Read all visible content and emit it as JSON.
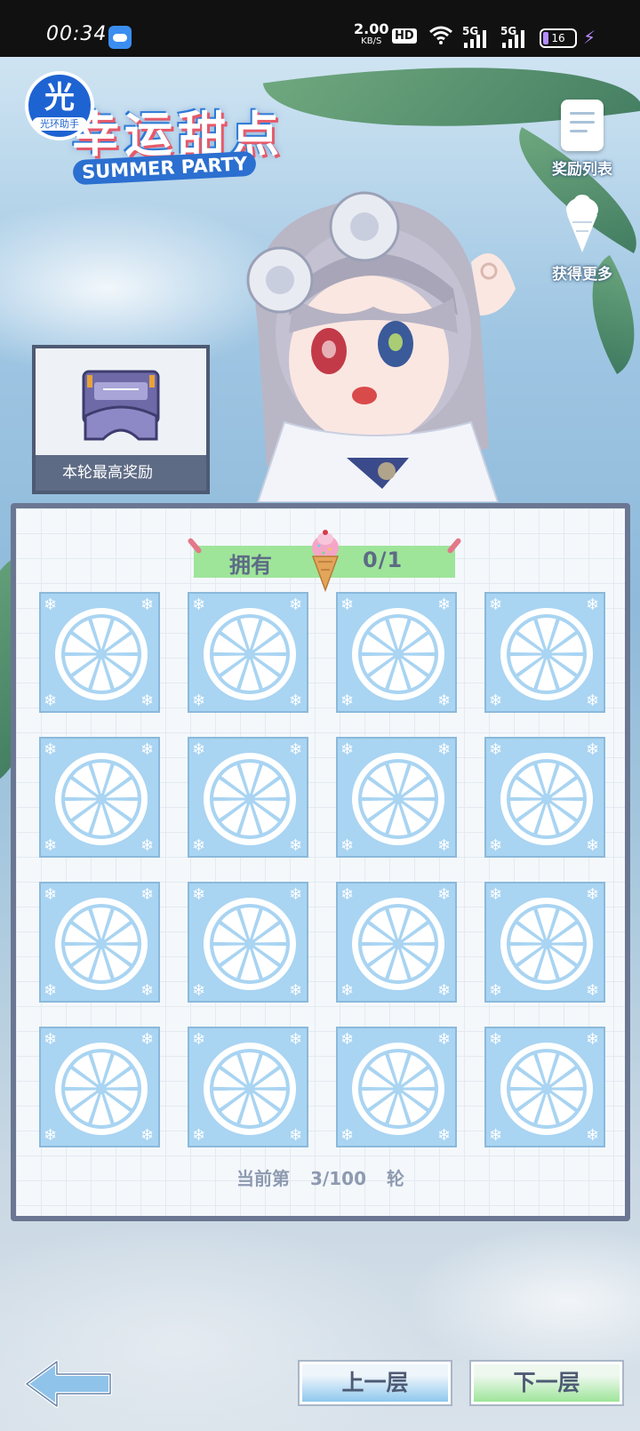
{
  "status_bar": {
    "time": "00:34",
    "speed_value": "2.00",
    "speed_unit": "KB/S",
    "hd_badge": "HD",
    "network1": "5G",
    "network2": "5G",
    "battery": "16"
  },
  "logo": {
    "title": "幸运甜点",
    "subtitle": "SUMMER PARTY",
    "assistant_big": "光",
    "assistant_small": "光环助手"
  },
  "side_buttons": {
    "reward_list": "奖励列表",
    "get_more": "获得更多"
  },
  "reward_box": {
    "label": "本轮最高奖励"
  },
  "board": {
    "own_label": "拥有",
    "own_count": "0/1",
    "tiles_rows": 4,
    "tiles_cols": 4,
    "round_prefix": "当前第",
    "round_value": "3/100",
    "round_suffix": "轮"
  },
  "controls": {
    "prev": "上一层",
    "next": "下一层"
  },
  "colors": {
    "tile_fill": "#a9d4f2",
    "board_frame": "#6b7792",
    "banner_green": "#9ee59a"
  }
}
